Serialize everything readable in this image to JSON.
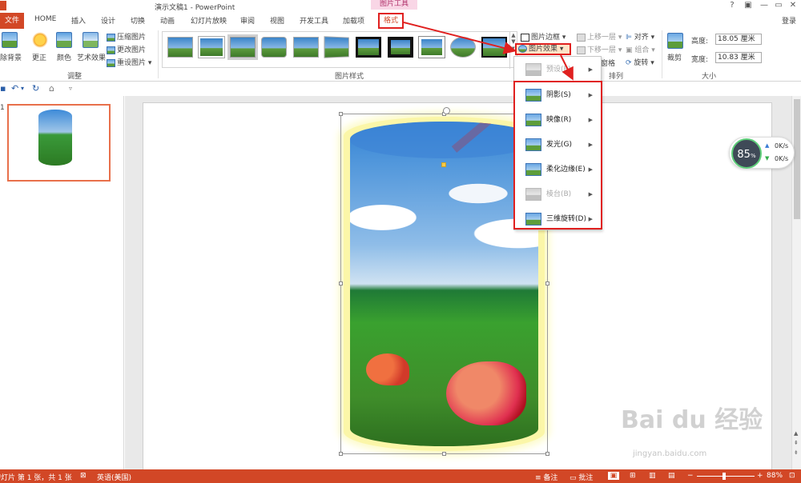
{
  "titlebar": {
    "doc_title": "演示文稿1 - PowerPoint",
    "contextual_group": "图片工具",
    "help": "?",
    "minimize": "—",
    "restore": "▭",
    "close": "✕"
  },
  "tabs": {
    "file": "文件",
    "items": [
      "HOME",
      "插入",
      "设计",
      "切换",
      "动画",
      "幻灯片放映",
      "审阅",
      "视图",
      "开发工具",
      "加载项"
    ],
    "format": "格式",
    "login": "登录"
  },
  "ribbon": {
    "remove_bg": "除背景",
    "corrections": "更正",
    "color": "颜色",
    "artistic": "艺术效果",
    "compress": "压缩图片",
    "change": "更改图片",
    "reset": "重设图片",
    "adjust_group": "调整",
    "styles_group": "图片样式",
    "border": "图片边框",
    "effects": "图片效果",
    "layout_label": "窗格",
    "bring_forward": "上移一层",
    "send_backward": "下移一层",
    "align": "对齐",
    "group": "组合",
    "rotate": "旋转",
    "arrange_group": "排列",
    "crop": "裁剪",
    "height_label": "高度:",
    "height_value": "18.05 厘米",
    "width_label": "宽度:",
    "width_value": "10.83 厘米",
    "size_group": "大小"
  },
  "menu": {
    "items": [
      {
        "label": "预设(P)",
        "disabled": true
      },
      {
        "label": "阴影(S)",
        "disabled": false
      },
      {
        "label": "映像(R)",
        "disabled": false
      },
      {
        "label": "发光(G)",
        "disabled": false
      },
      {
        "label": "柔化边缘(E)",
        "disabled": false
      },
      {
        "label": "棱台(B)",
        "disabled": true
      },
      {
        "label": "三维旋转(D)",
        "disabled": false
      }
    ]
  },
  "slides_pane": {
    "slide_number": "1"
  },
  "netwidget": {
    "percent": "85",
    "percent_sign": "%",
    "up": "0K/s",
    "down": "0K/s"
  },
  "statusbar": {
    "slide_info": "幻灯片 第 1 张，共 1 张",
    "language": "英语(美国)",
    "notes": "备注",
    "comments": "批注",
    "zoom": "88%"
  },
  "watermark": {
    "text": "Bai du 经验",
    "sub": "jingyan.baidu.com"
  },
  "colors": {
    "accent": "#d24726",
    "annotation": "#e0201f"
  }
}
